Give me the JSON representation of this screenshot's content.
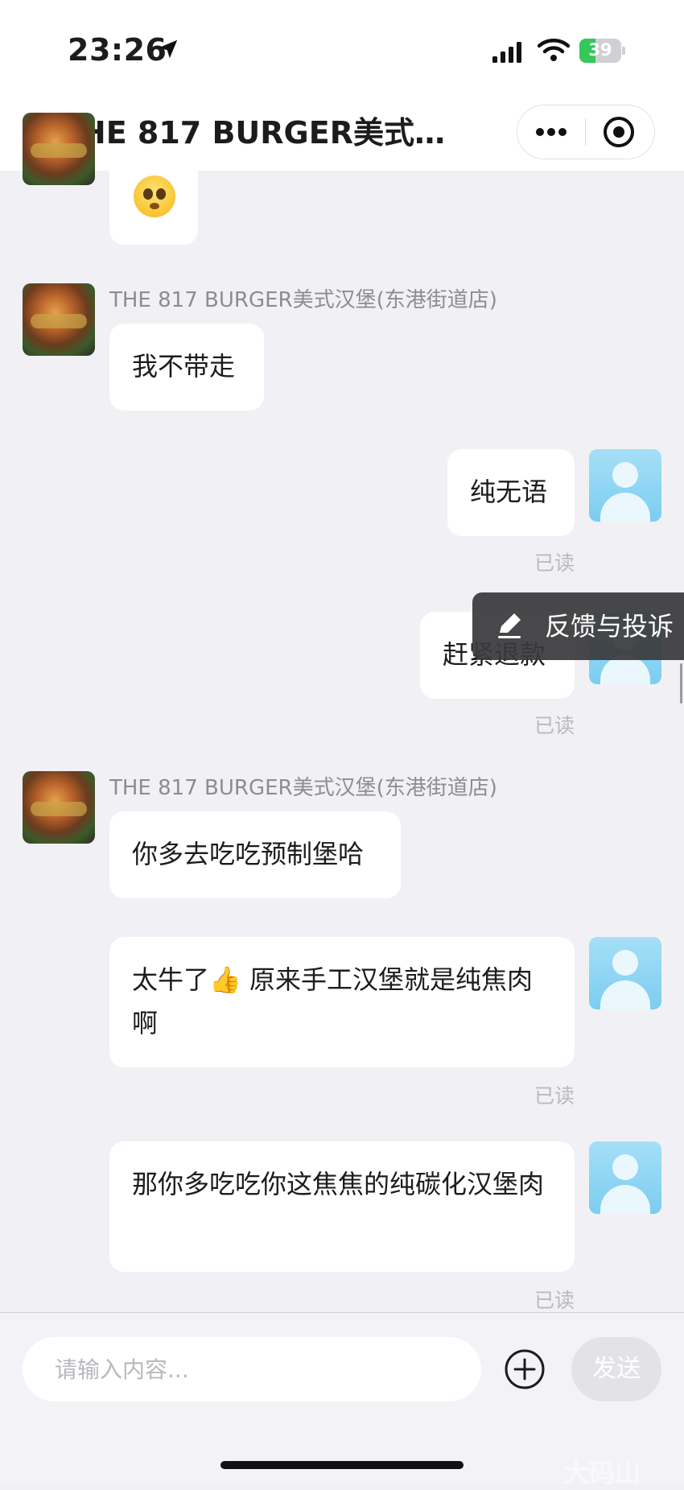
{
  "status_bar": {
    "time": "23:26",
    "battery": "39",
    "battery_level": 0.39
  },
  "nav": {
    "title": "THE 817 BURGER美式汉…"
  },
  "messages": [
    {
      "sender": "THE 817 BURGER美式汉堡(东港街道店)",
      "text": "我不带走"
    },
    {
      "text": "纯无语",
      "status": "已读"
    },
    {
      "text": "赶紧退款",
      "status": "已读"
    },
    {
      "sender": "THE 817 BURGER美式汉堡(东港街道店)",
      "text": "你多去吃吃预制堡哈"
    },
    {
      "text": "太牛了👍 原来手工汉堡就是纯焦肉啊",
      "status": "已读"
    },
    {
      "text": "那你多吃吃你这焦焦的纯碳化汉堡肉",
      "status": "已读"
    }
  ],
  "feedback": {
    "label": "反馈与投诉"
  },
  "input": {
    "placeholder": "请输入内容...",
    "send_label": "发送"
  },
  "watermark": "大码山"
}
